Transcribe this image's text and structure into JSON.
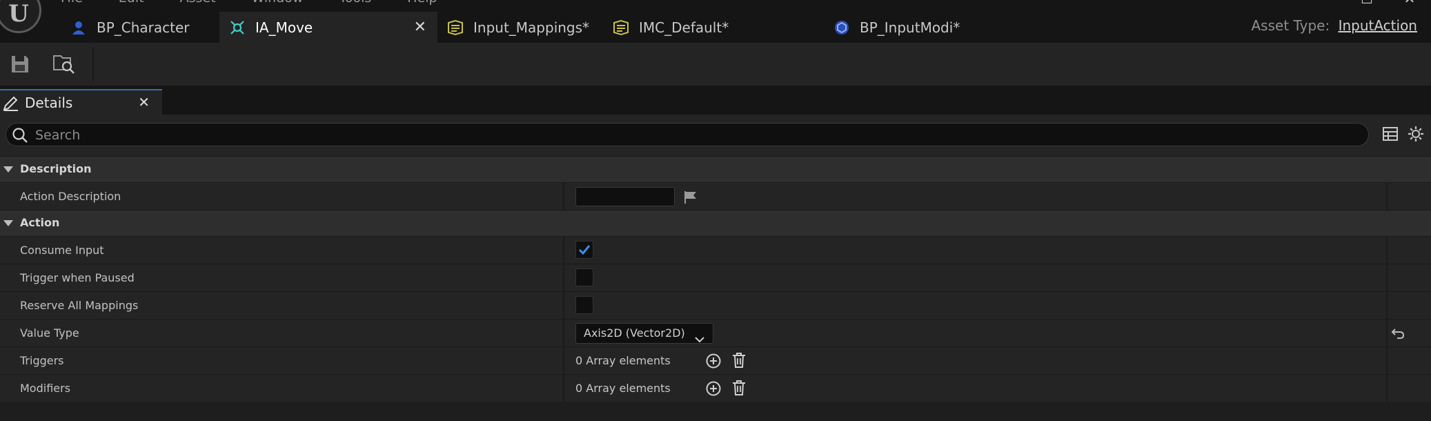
{
  "menu": [
    "File",
    "Edit",
    "Asset",
    "Window",
    "Tools",
    "Help"
  ],
  "tabs": [
    {
      "label": "BP_Character",
      "icon": "blueprint-character-icon"
    },
    {
      "label": "IA_Move",
      "icon": "input-action-icon",
      "active": true
    },
    {
      "label": "Input_Mappings*",
      "icon": "mapping-context-icon"
    },
    {
      "label": "IMC_Default*",
      "icon": "mapping-context-icon"
    },
    {
      "label": "BP_InputModi*",
      "icon": "blueprint-class-icon"
    }
  ],
  "asset_type": {
    "label": "Asset Type:",
    "value": "InputAction"
  },
  "details": {
    "tab_label": "Details",
    "search_placeholder": "Search",
    "sections": [
      {
        "title": "Description"
      },
      {
        "title": "Action"
      }
    ],
    "rows": {
      "action_description": {
        "label": "Action Description",
        "value": ""
      },
      "consume_input": {
        "label": "Consume Input",
        "checked": true
      },
      "trigger_when_paused": {
        "label": "Trigger when Paused",
        "checked": false
      },
      "reserve_all_mappings": {
        "label": "Reserve All Mappings",
        "checked": false
      },
      "value_type": {
        "label": "Value Type",
        "value": "Axis2D (Vector2D)"
      },
      "triggers": {
        "label": "Triggers",
        "value": "0 Array elements"
      },
      "modifiers": {
        "label": "Modifiers",
        "value": "0 Array elements"
      }
    }
  },
  "colors": {
    "accent": "#2f6fbf",
    "check": "#3b8ee8",
    "background": "#151515",
    "panel": "#242424"
  }
}
